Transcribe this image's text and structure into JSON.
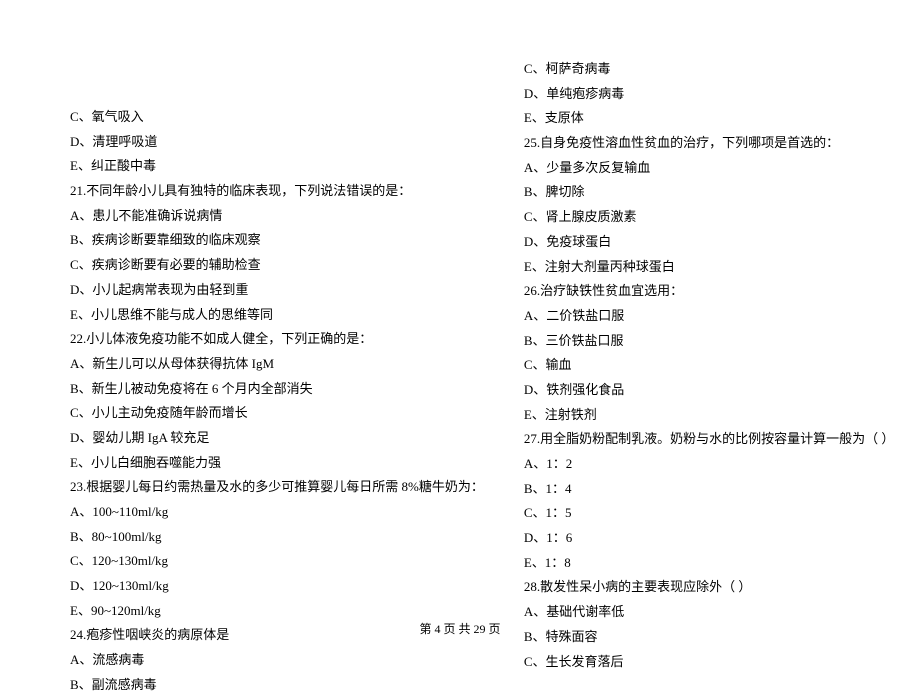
{
  "left_column": [
    "C、氧气吸入",
    "D、清理呼吸道",
    "E、纠正酸中毒",
    "21.不同年龄小儿具有独特的临床表现，下列说法错误的是：",
    "A、患儿不能准确诉说病情",
    "B、疾病诊断要靠细致的临床观察",
    "C、疾病诊断要有必要的辅助检查",
    "D、小儿起病常表现为由轻到重",
    "E、小儿思维不能与成人的思维等同",
    "22.小儿体液免疫功能不如成人健全，下列正确的是：",
    "A、新生儿可以从母体获得抗体 IgM",
    "B、新生儿被动免疫将在 6 个月内全部消失",
    "C、小儿主动免疫随年龄而增长",
    "D、婴幼儿期 IgA 较充足",
    "E、小儿白细胞吞噬能力强",
    "23.根据婴儿每日约需热量及水的多少可推算婴儿每日所需 8%糖牛奶为：",
    "A、100~110ml/kg",
    "B、80~100ml/kg",
    "C、120~130ml/kg",
    "D、120~130ml/kg",
    "E、90~120ml/kg",
    "24.疱疹性咽峡炎的病原体是",
    "A、流感病毒",
    "B、副流感病毒"
  ],
  "right_column": [
    "C、柯萨奇病毒",
    "D、单纯疱疹病毒",
    "E、支原体",
    "25.自身免疫性溶血性贫血的治疗，下列哪项是首选的：",
    "A、少量多次反复输血",
    "B、脾切除",
    "C、肾上腺皮质激素",
    "D、免疫球蛋白",
    "E、注射大剂量丙种球蛋白",
    "26.治疗缺铁性贫血宜选用：",
    "A、二价铁盐口服",
    "B、三价铁盐口服",
    "C、输血",
    "D、铁剂强化食品",
    "E、注射铁剂",
    "27.用全脂奶粉配制乳液。奶粉与水的比例按容量计算一般为（    ）",
    "A、1：2",
    "B、1：4",
    "C、1：5",
    "D、1：6",
    "E、1：8",
    "28.散发性呆小病的主要表现应除外（    ）",
    "A、基础代谢率低",
    "B、特殊面容",
    "C、生长发育落后"
  ],
  "footer": "第 4 页 共 29 页"
}
